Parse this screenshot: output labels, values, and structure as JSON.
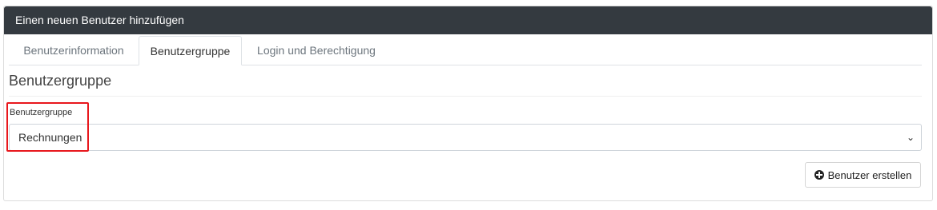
{
  "header": {
    "title": "Einen neuen Benutzer hinzufügen"
  },
  "tabs": [
    {
      "label": "Benutzerinformation",
      "active": false
    },
    {
      "label": "Benutzergruppe",
      "active": true
    },
    {
      "label": "Login und Berechtigung",
      "active": false
    }
  ],
  "section": {
    "title": "Benutzergruppe"
  },
  "form": {
    "group_label": "Benutzergruppe",
    "group_value": "Rechnungen",
    "chevron_icon": "chevron-down-icon"
  },
  "actions": {
    "create_label": "Benutzer erstellen",
    "create_icon": "plus-circle-icon"
  },
  "colors": {
    "header_bg": "#343a40",
    "highlight": "#e8171c"
  }
}
